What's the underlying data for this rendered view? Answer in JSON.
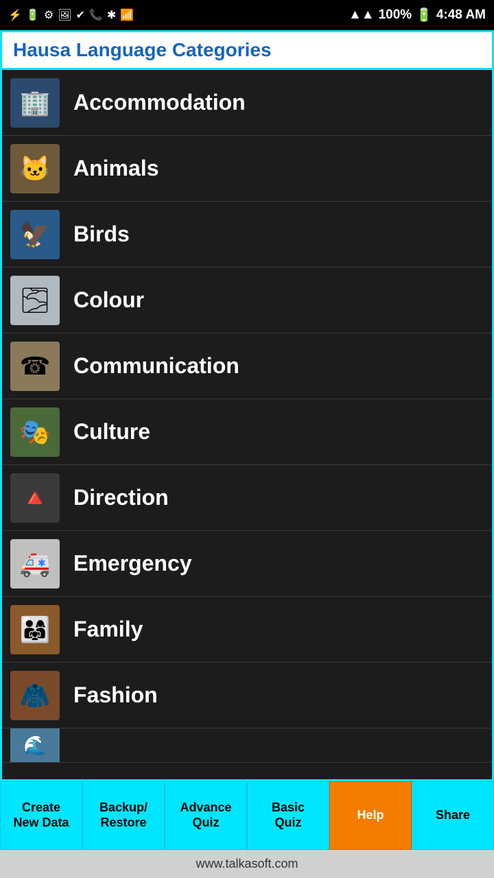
{
  "app": {
    "title": "Hausa Language Categories"
  },
  "statusBar": {
    "time": "4:48 AM",
    "battery": "100%",
    "signal": "▲▲▲▲"
  },
  "categories": [
    {
      "id": "accommodation",
      "label": "Accommodation",
      "thumbClass": "thumb-accommodation",
      "emoji": "🏢"
    },
    {
      "id": "animals",
      "label": "Animals",
      "thumbClass": "thumb-animals",
      "emoji": "🐱"
    },
    {
      "id": "birds",
      "label": "Birds",
      "thumbClass": "thumb-birds",
      "emoji": "🦅"
    },
    {
      "id": "colour",
      "label": "Colour",
      "thumbClass": "thumb-colour",
      "emoji": "🌫"
    },
    {
      "id": "communication",
      "label": "Communication",
      "thumbClass": "thumb-communication",
      "emoji": "☎"
    },
    {
      "id": "culture",
      "label": "Culture",
      "thumbClass": "thumb-culture",
      "emoji": "🎭"
    },
    {
      "id": "direction",
      "label": "Direction",
      "thumbClass": "thumb-direction",
      "emoji": "🔺"
    },
    {
      "id": "emergency",
      "label": "Emergency",
      "thumbClass": "thumb-emergency",
      "emoji": "🚑"
    },
    {
      "id": "family",
      "label": "Family",
      "thumbClass": "thumb-family",
      "emoji": "👨‍👩‍👧"
    },
    {
      "id": "fashion",
      "label": "Fashion",
      "thumbClass": "thumb-fashion",
      "emoji": "🧥"
    }
  ],
  "bottomButtons": [
    {
      "id": "create",
      "label": "Create\nNew Data",
      "active": false
    },
    {
      "id": "backup",
      "label": "Backup/\nRestore",
      "active": false
    },
    {
      "id": "advquiz",
      "label": "Advance\nQuiz",
      "active": false
    },
    {
      "id": "basicquiz",
      "label": "Basic\nQuiz",
      "active": false
    },
    {
      "id": "help",
      "label": "Help",
      "active": true
    },
    {
      "id": "share",
      "label": "Share",
      "active": false
    }
  ],
  "footer": {
    "url": "www.talkasoft.com"
  }
}
